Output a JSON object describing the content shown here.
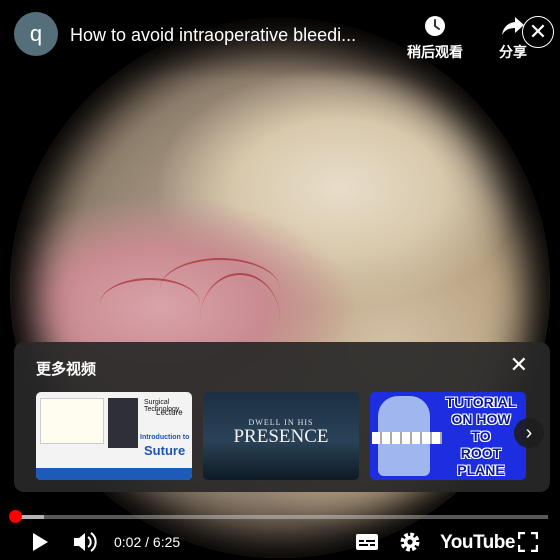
{
  "channel": {
    "avatar_letter": "q"
  },
  "video": {
    "title": "How to avoid intraoperative bleedi..."
  },
  "top_actions": {
    "watch_later_label": "稍后观看",
    "share_label": "分享",
    "watch_later_icon": "clock-icon",
    "share_icon": "share-arrow-icon"
  },
  "more_videos": {
    "title": "更多视频",
    "items": [
      {
        "lines": [
          "Surgical Technology",
          "Lecture",
          "Introduction to",
          "Suture"
        ]
      },
      {
        "lines": [
          "DWELL IN HIS",
          "PRESENCE"
        ]
      },
      {
        "lines": [
          "TUTORIAL",
          "ON HOW",
          "TO",
          "ROOT PLANE"
        ]
      }
    ]
  },
  "player": {
    "current_time": "0:02",
    "separator": "/",
    "duration": "6:25",
    "progress_fraction": 0.005,
    "buffered_fraction": 0.06,
    "brand": "YouTube",
    "accent_color": "#ff0000",
    "icons": [
      "play-icon",
      "volume-icon",
      "subtitles-icon",
      "settings-gear-icon",
      "fullscreen-icon"
    ]
  }
}
